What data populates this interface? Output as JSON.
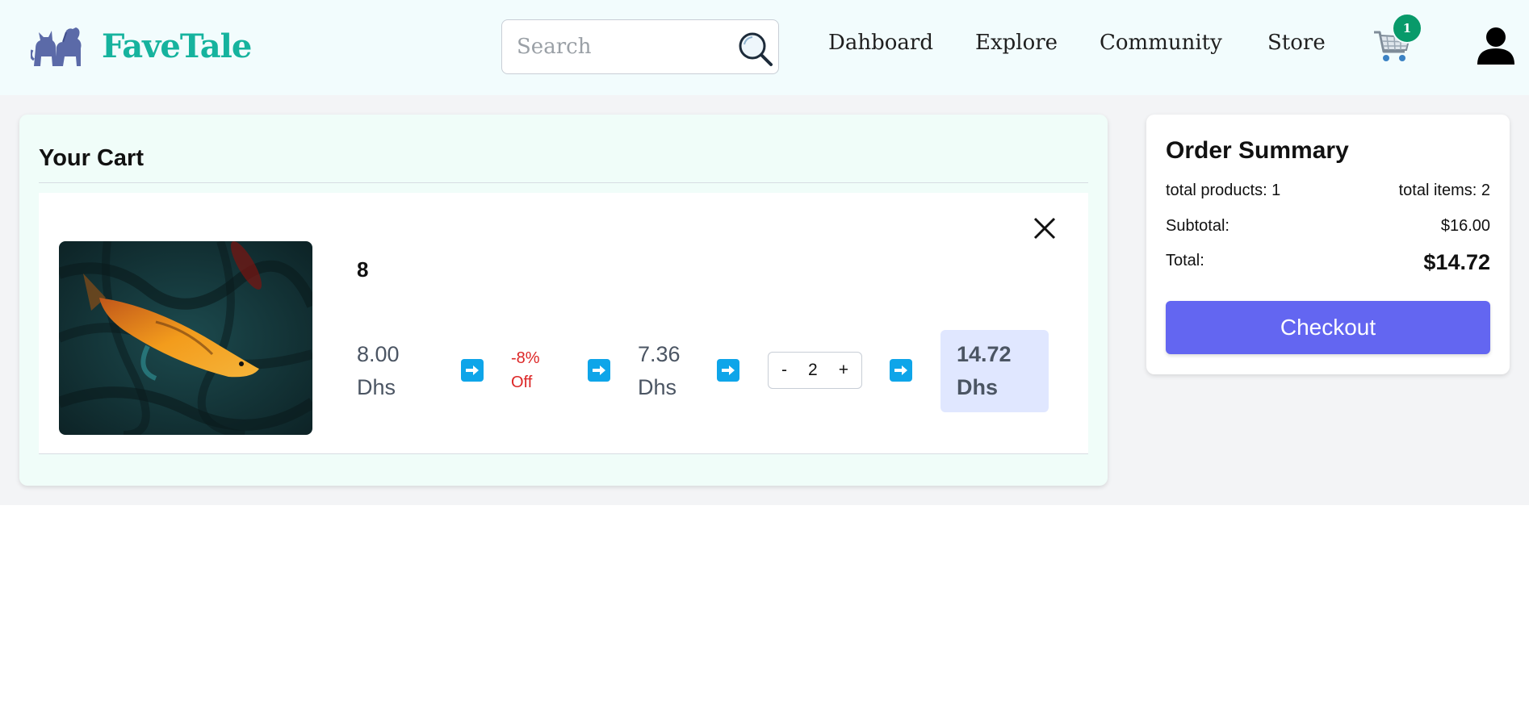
{
  "brand": {
    "name": "FaveTale",
    "color": "#16b39e"
  },
  "search": {
    "placeholder": "Search"
  },
  "nav": [
    {
      "label": "Dahboard"
    },
    {
      "label": "Explore"
    },
    {
      "label": "Community"
    },
    {
      "label": "Store"
    }
  ],
  "cart_badge": {
    "count": "1"
  },
  "cart": {
    "title": "Your Cart",
    "items": [
      {
        "name": "8",
        "original_price": "8.00\nDhs",
        "discount": "-8%\nOff",
        "discounted_price": "7.36\nDhs",
        "quantity": "2",
        "qty_minus": "-",
        "qty_plus": "+",
        "line_total": "14.72\nDhs"
      }
    ]
  },
  "summary": {
    "title": "Order Summary",
    "total_products": "total products: 1",
    "total_items": "total items: 2",
    "subtotal_label": "Subtotal:",
    "subtotal_value": "$16.00",
    "total_label": "Total:",
    "total_value": "$14.72",
    "checkout_label": "Checkout"
  },
  "colors": {
    "header_bg": "#f2fcfd",
    "accent_checkout": "#6366f1",
    "arrow_blue": "#0ea5e9",
    "discount_red": "#dc2626",
    "badge_green": "#089a6a"
  }
}
